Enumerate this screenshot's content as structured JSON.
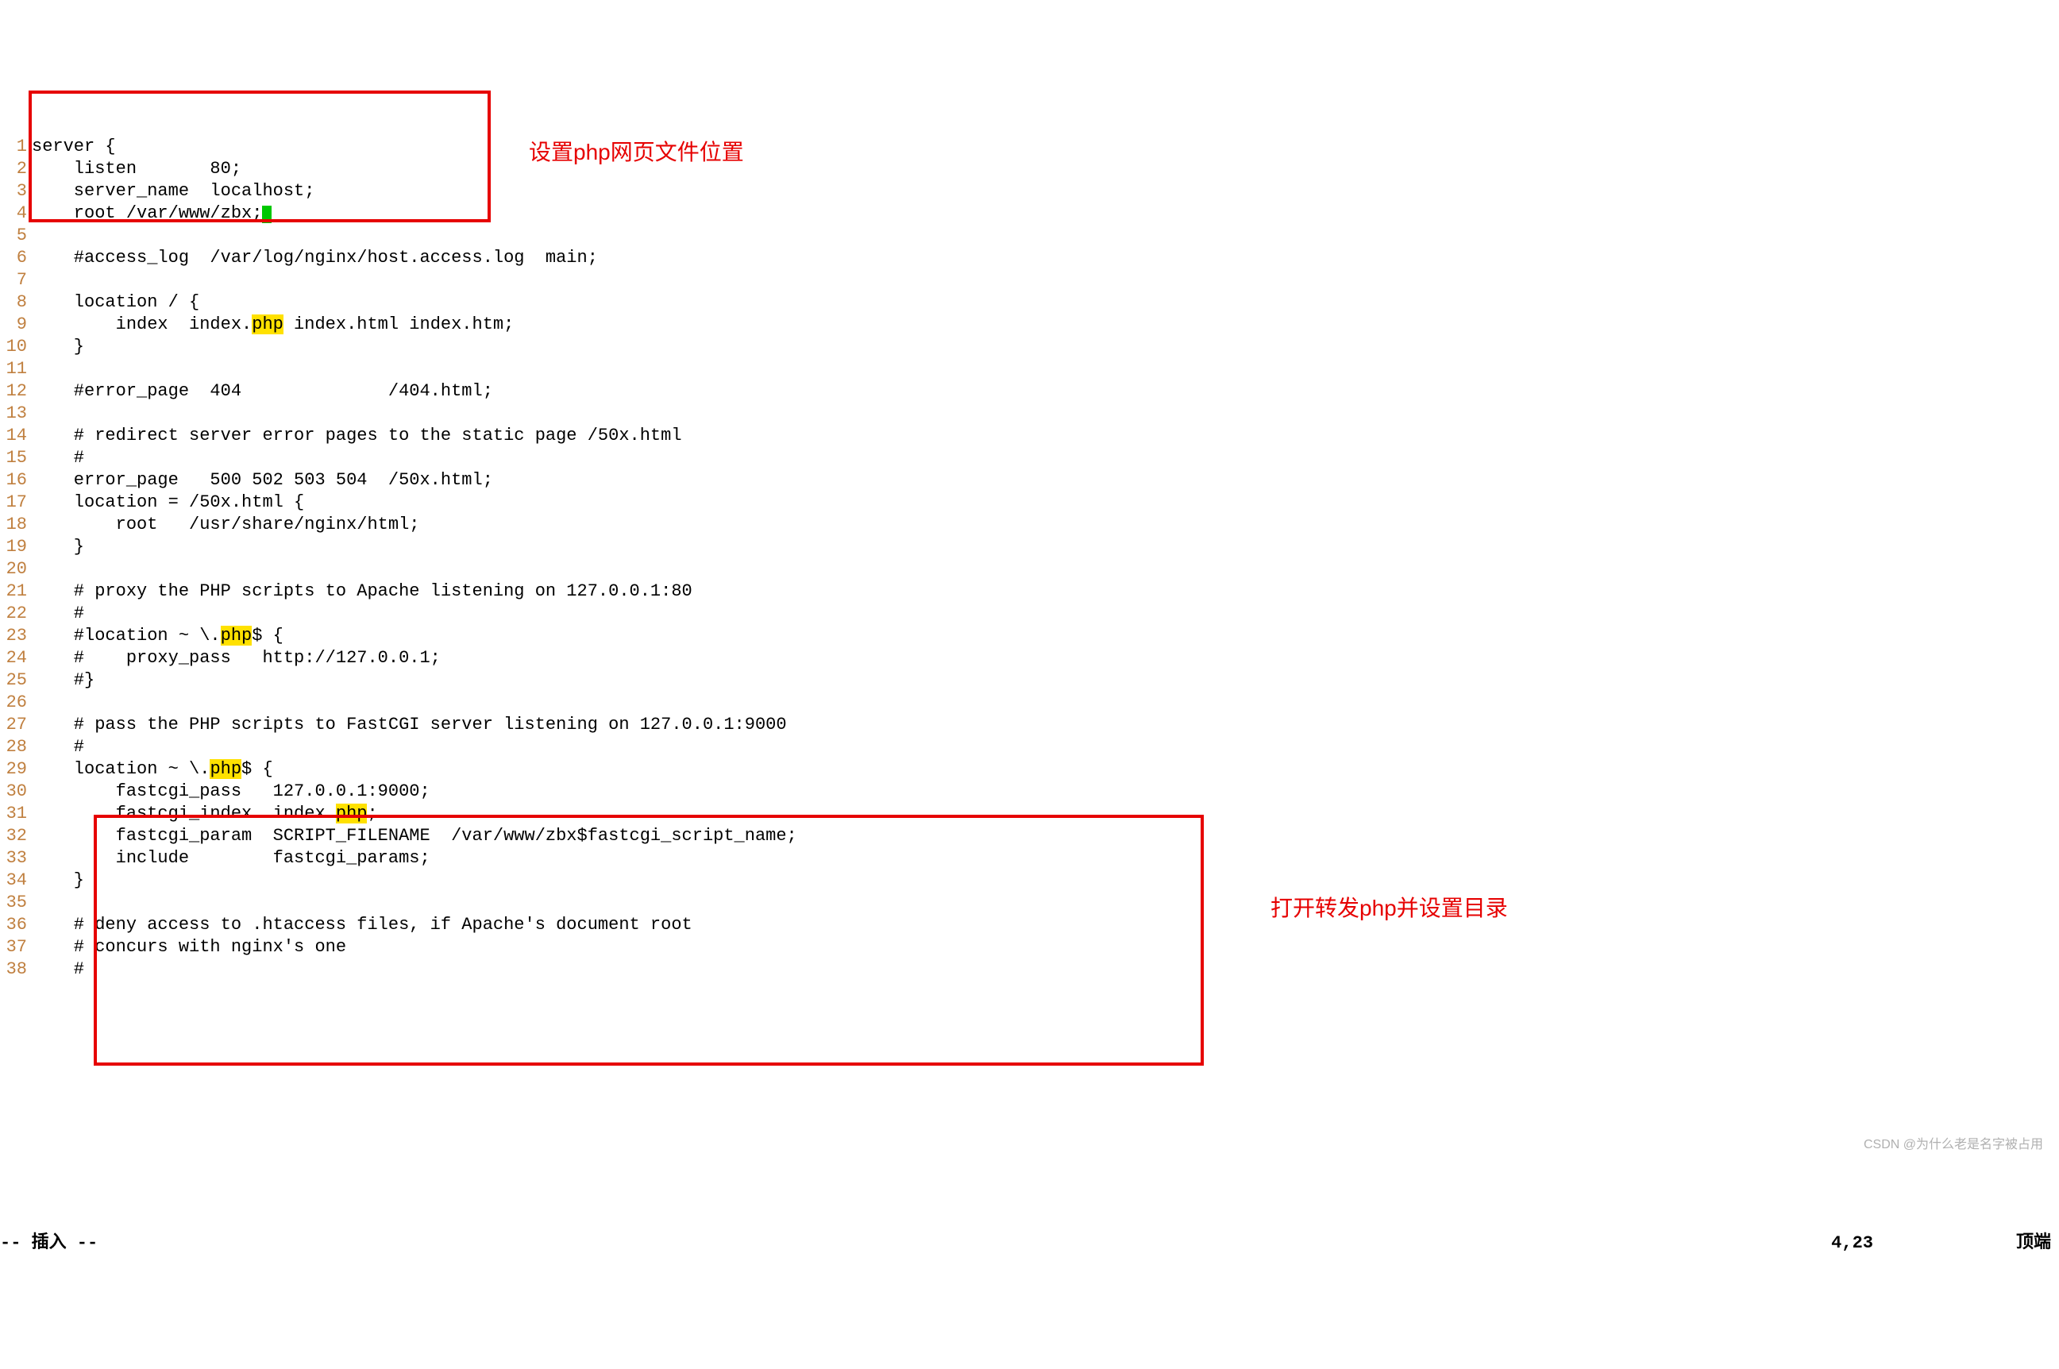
{
  "annotations": {
    "top": "设置php网页文件位置",
    "bottom": "打开转发php并设置目录"
  },
  "status": {
    "mode": "-- 插入 --",
    "pos": "4,23",
    "loc": "顶端"
  },
  "watermark": "CSDN @为什么老是名字被占用",
  "highlights": {
    "php": "php"
  },
  "lines": [
    {
      "n": "1",
      "pre": "server {",
      "hl": "",
      "post": ""
    },
    {
      "n": "2",
      "pre": "    listen       80;",
      "hl": "",
      "post": ""
    },
    {
      "n": "3",
      "pre": "    server_name  localhost;",
      "hl": "",
      "post": ""
    },
    {
      "n": "4",
      "pre": "    root /var/www/zbx;",
      "hl": "",
      "post": "",
      "cursor": true
    },
    {
      "n": "5",
      "pre": "",
      "hl": "",
      "post": ""
    },
    {
      "n": "6",
      "pre": "    #access_log  /var/log/nginx/host.access.log  main;",
      "hl": "",
      "post": ""
    },
    {
      "n": "7",
      "pre": "",
      "hl": "",
      "post": ""
    },
    {
      "n": "8",
      "pre": "    location / {",
      "hl": "",
      "post": ""
    },
    {
      "n": "9",
      "pre": "        index  index.",
      "hl": "php",
      "post": " index.html index.htm;"
    },
    {
      "n": "10",
      "pre": "    }",
      "hl": "",
      "post": ""
    },
    {
      "n": "11",
      "pre": "",
      "hl": "",
      "post": ""
    },
    {
      "n": "12",
      "pre": "    #error_page  404              /404.html;",
      "hl": "",
      "post": ""
    },
    {
      "n": "13",
      "pre": "",
      "hl": "",
      "post": ""
    },
    {
      "n": "14",
      "pre": "    # redirect server error pages to the static page /50x.html",
      "hl": "",
      "post": ""
    },
    {
      "n": "15",
      "pre": "    #",
      "hl": "",
      "post": ""
    },
    {
      "n": "16",
      "pre": "    error_page   500 502 503 504  /50x.html;",
      "hl": "",
      "post": ""
    },
    {
      "n": "17",
      "pre": "    location = /50x.html {",
      "hl": "",
      "post": ""
    },
    {
      "n": "18",
      "pre": "        root   /usr/share/nginx/html;",
      "hl": "",
      "post": ""
    },
    {
      "n": "19",
      "pre": "    }",
      "hl": "",
      "post": ""
    },
    {
      "n": "20",
      "pre": "",
      "hl": "",
      "post": ""
    },
    {
      "n": "21",
      "pre": "    # proxy the PHP scripts to Apache listening on 127.0.0.1:80",
      "hl": "",
      "post": ""
    },
    {
      "n": "22",
      "pre": "    #",
      "hl": "",
      "post": ""
    },
    {
      "n": "23",
      "pre": "    #location ~ \\.",
      "hl": "php",
      "post": "$ {"
    },
    {
      "n": "24",
      "pre": "    #    proxy_pass   http://127.0.0.1;",
      "hl": "",
      "post": ""
    },
    {
      "n": "25",
      "pre": "    #}",
      "hl": "",
      "post": ""
    },
    {
      "n": "26",
      "pre": "",
      "hl": "",
      "post": ""
    },
    {
      "n": "27",
      "pre": "    # pass the PHP scripts to FastCGI server listening on 127.0.0.1:9000",
      "hl": "",
      "post": ""
    },
    {
      "n": "28",
      "pre": "    #",
      "hl": "",
      "post": ""
    },
    {
      "n": "29",
      "pre": "    location ~ \\.",
      "hl": "php",
      "post": "$ {"
    },
    {
      "n": "30",
      "pre": "        fastcgi_pass   127.0.0.1:9000;",
      "hl": "",
      "post": ""
    },
    {
      "n": "31",
      "pre": "        fastcgi_index  index.",
      "hl": "php",
      "post": ";"
    },
    {
      "n": "32",
      "pre": "        fastcgi_param  SCRIPT_FILENAME  /var/www/zbx$fastcgi_script_name;",
      "hl": "",
      "post": ""
    },
    {
      "n": "33",
      "pre": "        include        fastcgi_params;",
      "hl": "",
      "post": ""
    },
    {
      "n": "34",
      "pre": "    }",
      "hl": "",
      "post": ""
    },
    {
      "n": "35",
      "pre": "",
      "hl": "",
      "post": ""
    },
    {
      "n": "36",
      "pre": "    # deny access to .htaccess files, if Apache's document root",
      "hl": "",
      "post": ""
    },
    {
      "n": "37",
      "pre": "    # concurs with nginx's one",
      "hl": "",
      "post": ""
    },
    {
      "n": "38",
      "pre": "    #",
      "hl": "",
      "post": ""
    }
  ]
}
